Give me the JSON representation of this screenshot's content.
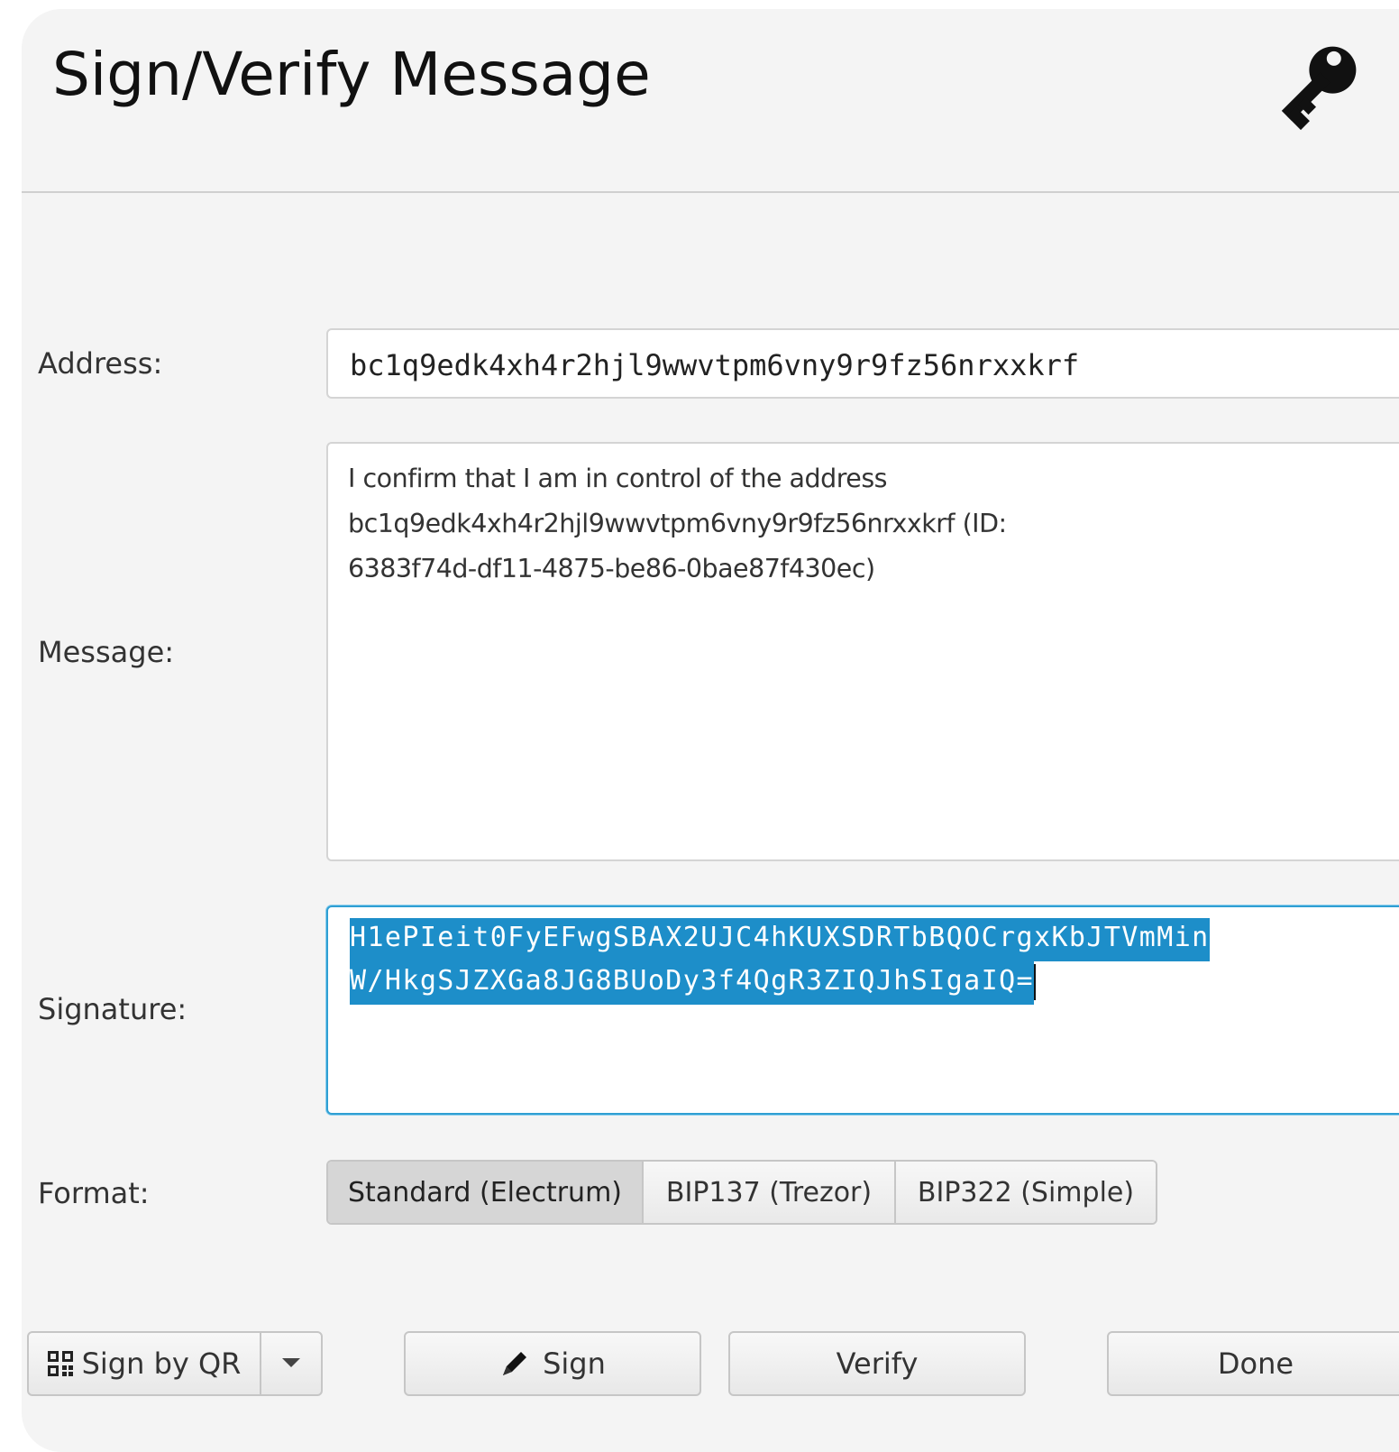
{
  "dialog": {
    "title": "Sign/Verify Message",
    "icon": "key-icon"
  },
  "form": {
    "address_label": "Address:",
    "address_value": "bc1q9edk4xh4r2hjl9wwvtpm6vny9r9fz56nrxxkrf",
    "message_label": "Message:",
    "message_lines": [
      "I confirm that I am in control of the address",
      "bc1q9edk4xh4r2hjl9wwvtpm6vny9r9fz56nrxxkrf (ID:",
      "6383f74d-df11-4875-be86-0bae87f430ec)"
    ],
    "signature_label": "Signature:",
    "signature_lines": [
      "H1ePIeit0FyEFwgSBAX2UJC4hKUXSDRTbBQOCrgxKbJTVmMin",
      "W/HkgSJZXGa8JG8BUoDy3f4QgR3ZIQJhSIgaIQ="
    ],
    "format_label": "Format:",
    "format_options": [
      "Standard (Electrum)",
      "BIP137 (Trezor)",
      "BIP322 (Simple)"
    ],
    "format_selected": "Standard (Electrum)"
  },
  "buttons": {
    "sign_by_qr": "Sign by QR",
    "sign": "Sign",
    "verify": "Verify",
    "done": "Done"
  },
  "colors": {
    "selection": "#1d8ec9",
    "focus_border": "#2f9fd3",
    "background": "#f4f4f4"
  }
}
